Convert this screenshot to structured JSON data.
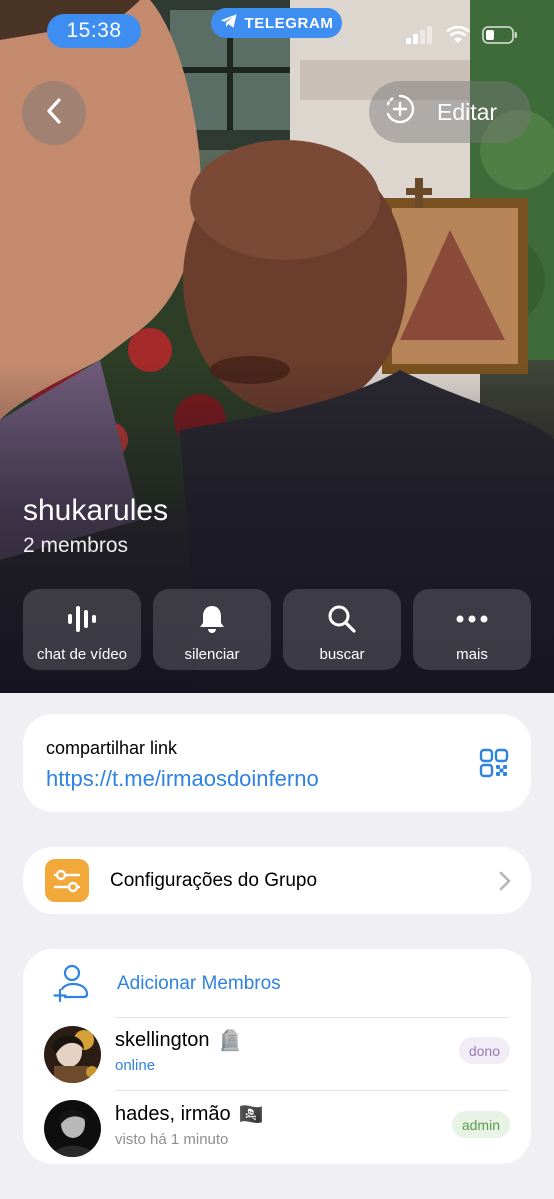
{
  "status_bar": {
    "time": "15:38",
    "app": "TELEGRAM"
  },
  "header": {
    "edit_label": "Editar"
  },
  "group": {
    "name": "shukarules",
    "members_count": "2 membros"
  },
  "actions": [
    {
      "label": "chat de vídeo",
      "icon": "voice-chat-icon"
    },
    {
      "label": "silenciar",
      "icon": "bell-icon"
    },
    {
      "label": "buscar",
      "icon": "search-icon"
    },
    {
      "label": "mais",
      "icon": "more-icon"
    }
  ],
  "link": {
    "title": "compartilhar link",
    "url": "https://t.me/irmaosdoinferno"
  },
  "settings": {
    "label": "Configurações do Grupo"
  },
  "members": {
    "add_label": "Adicionar Membros",
    "list": [
      {
        "name": "skellington",
        "emoji": "🪦",
        "status": "online",
        "role": "dono"
      },
      {
        "name": "hades, irmão",
        "emoji": "🏴‍☠️",
        "status": "visto há 1 minuto",
        "role": "admin"
      }
    ]
  },
  "colors": {
    "accent": "#2f83e0",
    "status_pill": "#3d8ef0",
    "settings_icon": "#f3a93a",
    "owner_badge_text": "#9b7bb8",
    "owner_badge_bg": "#f1ecf5",
    "admin_badge_text": "#5a9a4f",
    "admin_badge_bg": "#e8f3e6"
  }
}
